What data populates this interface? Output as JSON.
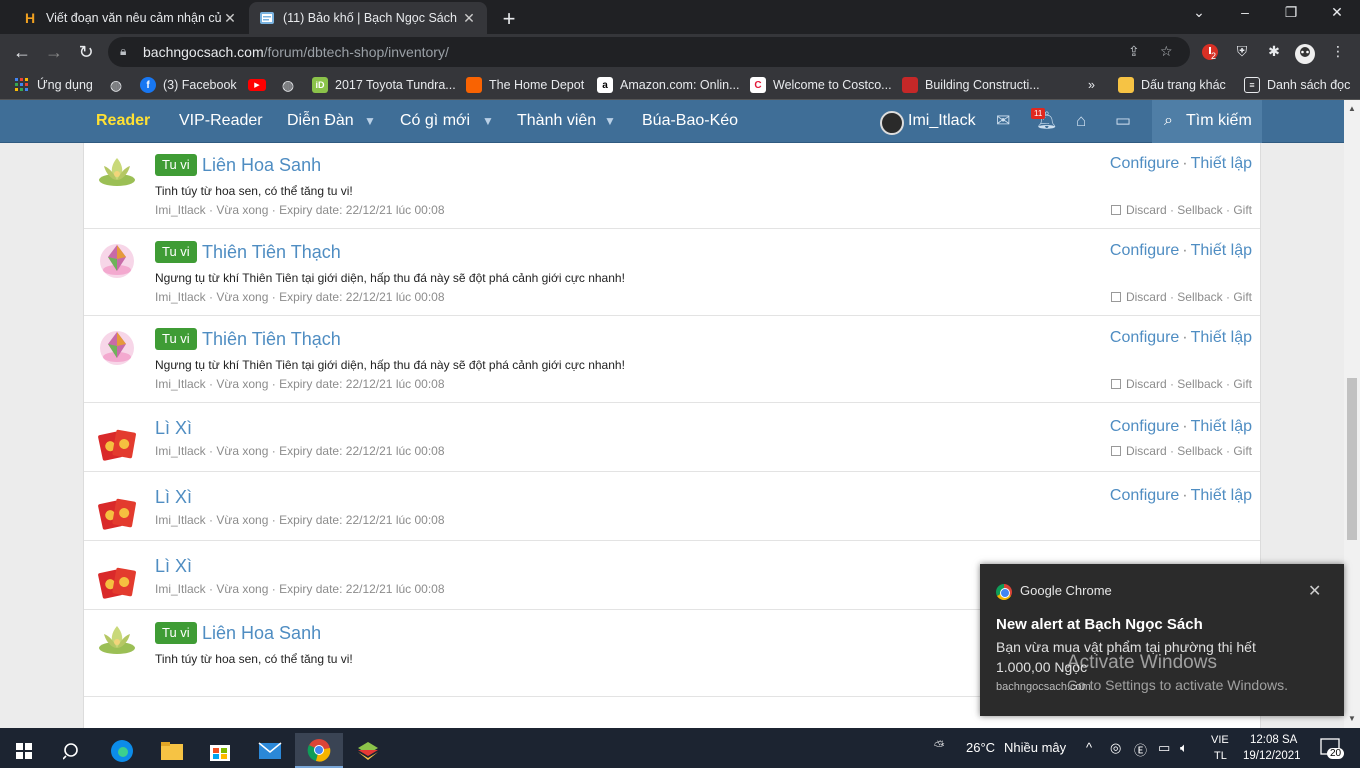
{
  "tabs": [
    {
      "title": "Viết đoạn văn nêu cảm nhận của",
      "favicon": "H"
    },
    {
      "title": "(11) Bảo khố | Bạch Ngọc Sách",
      "favicon": "book-icon"
    }
  ],
  "window_controls": {
    "dropdown": "⌄",
    "minimize": "–",
    "restore": "❐",
    "close": "✕"
  },
  "address": {
    "domain": "bachngocsach.com",
    "path": "/forum/dbtech-shop/inventory/"
  },
  "extension_badge": "2",
  "bookmarks": [
    {
      "label": "Ứng dụng",
      "icon": "apps-grid-icon"
    },
    {
      "label": "",
      "icon": "globe-icon"
    },
    {
      "label": "(3) Facebook",
      "icon": "facebook-icon"
    },
    {
      "label": "",
      "icon": "youtube-icon"
    },
    {
      "label": "",
      "icon": "globe-icon"
    },
    {
      "label": "2017 Toyota Tundra...",
      "icon": "id-icon"
    },
    {
      "label": "The Home Depot",
      "icon": "home-depot-icon"
    },
    {
      "label": "Amazon.com: Onlin...",
      "icon": "amazon-icon"
    },
    {
      "label": "Welcome to Costco...",
      "icon": "costco-icon"
    },
    {
      "label": "Building Constructi...",
      "icon": "building-icon"
    },
    {
      "label": "»",
      "icon": ""
    },
    {
      "label": "Dấu trang khác",
      "icon": "folder-icon"
    },
    {
      "label": "Danh sách đọc",
      "icon": "reading-list-icon"
    }
  ],
  "forum_nav": {
    "brand": "Reader",
    "items": [
      "VIP-Reader",
      "Diễn Đàn",
      "Có gì mới",
      "Thành viên",
      "Búa-Bao-Kéo"
    ],
    "username": "Imi_Itlack",
    "alerts_badge": "11",
    "search": "Tìm kiếm"
  },
  "inventory": [
    {
      "tag": "Tu vi",
      "name": "Liên Hoa Sanh",
      "desc": "Tinh túy từ hoa sen, có thể tăng tu vi!",
      "meta": "Imi_Itlack · Vừa xong · Expiry date: 22/12/21 lúc 00:08",
      "configure": "Configure",
      "setup": "Thiết lập",
      "discard": "Discard",
      "sellback": "Sellback",
      "gift": "Gift",
      "thumb": "lotus"
    },
    {
      "tag": "Tu vi",
      "name": "Liên Hoa Sanh",
      "desc": "Tinh túy từ hoa sen, có thể tăng tu vi!",
      "meta": "Imi_Itlack · Vừa xong · Expiry date: 22/12/21 lúc 00:08",
      "configure": "Configure",
      "setup": "Thiết lập",
      "discard": "Discard",
      "sellback": "Sellback",
      "gift": "Gift",
      "thumb": "lotus"
    },
    {
      "tag": "Tu vi",
      "name": "Thiên Tiên Thạch",
      "desc": "Ngưng tụ từ khí Thiên Tiên tại giới diện, hấp thu đá này sẽ đột phá cảnh giới cực nhanh!",
      "meta": "Imi_Itlack · Vừa xong · Expiry date: 22/12/21 lúc 00:08",
      "configure": "Configure",
      "setup": "Thiết lập",
      "discard": "Discard",
      "sellback": "Sellback",
      "gift": "Gift",
      "thumb": "gem"
    },
    {
      "tag": "Tu vi",
      "name": "Thiên Tiên Thạch",
      "desc": "Ngưng tụ từ khí Thiên Tiên tại giới diện, hấp thu đá này sẽ đột phá cảnh giới cực nhanh!",
      "meta": "Imi_Itlack · Vừa xong · Expiry date: 22/12/21 lúc 00:08",
      "configure": "Configure",
      "setup": "Thiết lập",
      "discard": "Discard",
      "sellback": "Sellback",
      "gift": "Gift",
      "thumb": "gem"
    },
    {
      "tag": "",
      "name": "Lì Xì",
      "desc": "",
      "meta": "Imi_Itlack · Vừa xong · Expiry date: 22/12/21 lúc 00:08",
      "configure": "Configure",
      "setup": "Thiết lập",
      "discard": "Discard",
      "sellback": "Sellback",
      "gift": "Gift",
      "thumb": "envelope"
    },
    {
      "tag": "",
      "name": "Lì Xì",
      "desc": "",
      "meta": "Imi_Itlack · Vừa xong · Expiry date: 22/12/21 lúc 00:08",
      "configure": "Configure",
      "setup": "Thiết lập",
      "discard": "",
      "sellback": "",
      "gift": "",
      "thumb": "envelope"
    },
    {
      "tag": "",
      "name": "Lì Xì",
      "desc": "",
      "meta": "Imi_Itlack · Vừa xong · Expiry date: 22/12/21 lúc 00:08",
      "configure": "",
      "setup": "",
      "discard": "",
      "sellback": "",
      "gift": "",
      "thumb": "envelope"
    },
    {
      "tag": "Tu vi",
      "name": "Liên Hoa Sanh",
      "desc": "Tinh túy từ hoa sen, có thể tăng tu vi!",
      "meta": "",
      "configure": "",
      "setup": "",
      "discard": "",
      "sellback": "",
      "gift": "",
      "thumb": "lotus"
    }
  ],
  "toast": {
    "app": "Google Chrome",
    "title": "New alert at Bạch Ngọc Sách",
    "body": "Bạn vừa mua vật phẩm tại phường thị hết 1.000,00 Ngọc",
    "site": "bachngocsach.com"
  },
  "watermark": {
    "line1": "Activate Windows",
    "line2": "Go to Settings to activate Windows."
  },
  "taskbar": {
    "weather_temp": "26°C",
    "weather_text": "Nhiều mây",
    "lang_top": "VIE",
    "lang_bottom": "TL",
    "time": "12:08 SA",
    "date": "19/12/2021",
    "notif_count": "20"
  }
}
